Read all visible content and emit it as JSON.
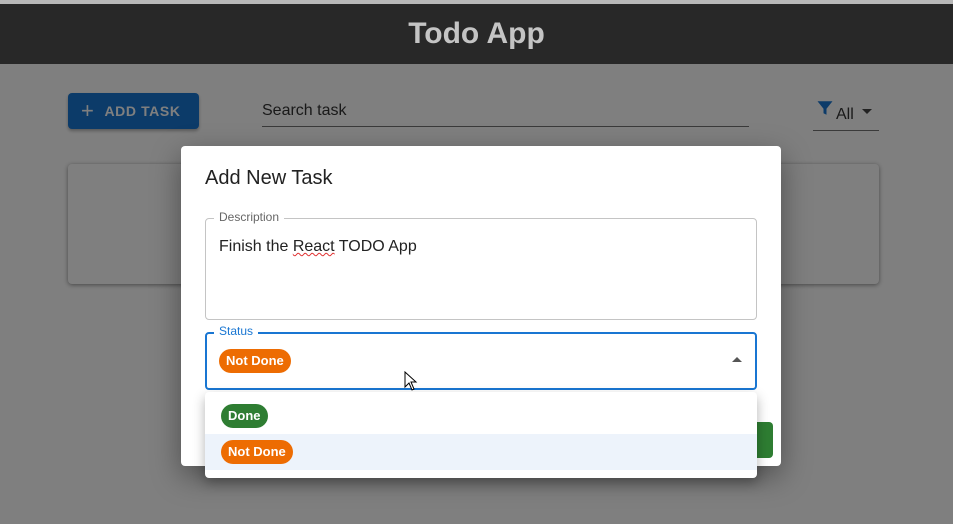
{
  "app": {
    "title": "Todo App"
  },
  "toolbar": {
    "add_task_label": "ADD TASK",
    "search_placeholder": "Search task",
    "filter_value": "All"
  },
  "dialog": {
    "title": "Add New Task",
    "description": {
      "label": "Description",
      "value_before": "Finish the ",
      "value_misspelled": "React",
      "value_after": " TODO App"
    },
    "status": {
      "label": "Status",
      "selected": "Not Done",
      "options": [
        {
          "label": "Done",
          "color": "#2e7d32"
        },
        {
          "label": "Not Done",
          "color": "#ed6c02"
        }
      ]
    }
  },
  "colors": {
    "primary": "#1976d2",
    "done": "#2e7d32",
    "not_done": "#ed6c02",
    "app_bar": "#282828"
  }
}
